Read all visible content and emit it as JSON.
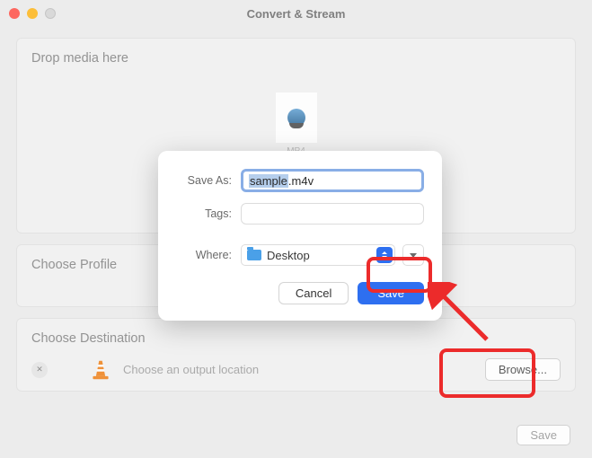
{
  "window": {
    "title": "Convert & Stream"
  },
  "drop": {
    "title": "Drop media here",
    "caption": "MP4"
  },
  "profile": {
    "title": "Choose Profile"
  },
  "destination": {
    "title": "Choose Destination",
    "placeholder": "Choose an output location",
    "browse": "Browse..."
  },
  "footer": {
    "save": "Save"
  },
  "sheet": {
    "saveAsLabel": "Save As:",
    "filenameSelected": "sample",
    "filenameExt": ".m4v",
    "tagsLabel": "Tags:",
    "whereLabel": "Where:",
    "whereValue": "Desktop",
    "cancel": "Cancel",
    "save": "Save"
  },
  "annotations": {
    "highlightColor": "#ec2b2b"
  }
}
